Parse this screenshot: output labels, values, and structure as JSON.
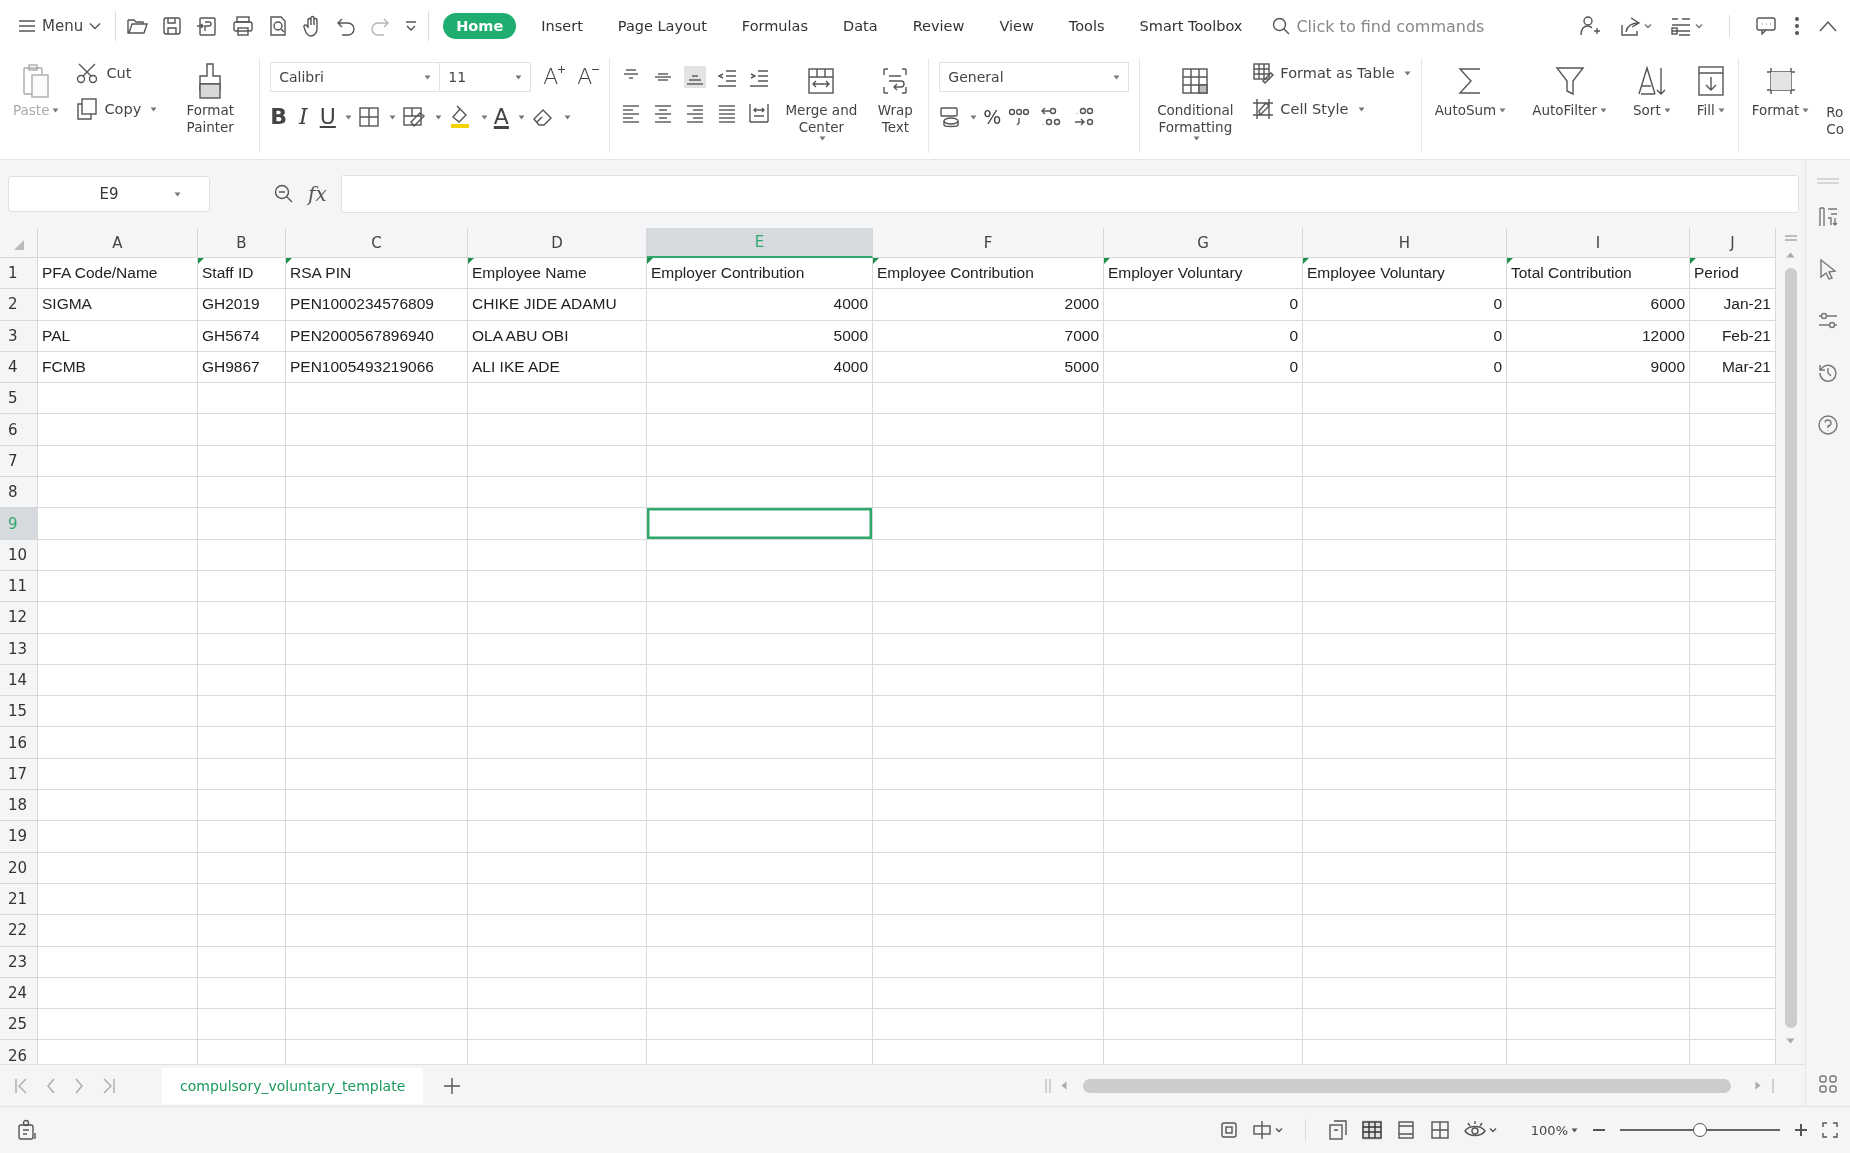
{
  "menu_bar": {
    "menu_label": "Menu",
    "tabs": [
      {
        "label": "Home",
        "selected": true
      },
      {
        "label": "Insert",
        "selected": false
      },
      {
        "label": "Page Layout",
        "selected": false
      },
      {
        "label": "Formulas",
        "selected": false
      },
      {
        "label": "Data",
        "selected": false
      },
      {
        "label": "Review",
        "selected": false
      },
      {
        "label": "View",
        "selected": false
      },
      {
        "label": "Tools",
        "selected": false
      },
      {
        "label": "Smart Toolbox",
        "selected": false
      }
    ],
    "search": {
      "placeholder": "Click to find commands"
    }
  },
  "ribbon": {
    "paste": {
      "label": "Paste",
      "disabled": true
    },
    "cut": "Cut",
    "copy": "Copy",
    "format_painter": "Format Painter",
    "font": "Calibri",
    "font_size": "11",
    "font_grow": "A",
    "font_shrink": "A",
    "bold": "B",
    "italic": "I",
    "underline": "U",
    "font_color": "A",
    "merge": "Merge and Center",
    "wrap": "Wrap Text",
    "number_format": "General",
    "percent": "%",
    "conditional": "Conditional Formatting",
    "format_table": "Format as Table",
    "cell_style": "Cell Style",
    "autosum": "AutoSum",
    "autofilter": "AutoFilter",
    "sort": "Sort",
    "fill": "Fill",
    "format": "Format",
    "cut_off": "Ro Co"
  },
  "formula_bar": {
    "name_box": "E9",
    "fx": "fx"
  },
  "columns": [
    {
      "letter": "A",
      "selected": false
    },
    {
      "letter": "B",
      "selected": false
    },
    {
      "letter": "C",
      "selected": false
    },
    {
      "letter": "D",
      "selected": false
    },
    {
      "letter": "E",
      "selected": true
    },
    {
      "letter": "F",
      "selected": false
    },
    {
      "letter": "G",
      "selected": false
    },
    {
      "letter": "H",
      "selected": false
    },
    {
      "letter": "I",
      "selected": false
    },
    {
      "letter": "J",
      "selected": false
    }
  ],
  "header_row": {
    "number": "1",
    "selected": false,
    "cells": [
      {
        "text": "PFA Code/Name",
        "flag": false
      },
      {
        "text": "Staff ID",
        "flag": true
      },
      {
        "text": "RSA PIN",
        "flag": true
      },
      {
        "text": "Employee Name",
        "flag": true
      },
      {
        "text": "Employer Contribution",
        "flag": true
      },
      {
        "text": "Employee Contribution",
        "flag": true
      },
      {
        "text": "Employer Voluntary",
        "flag": true
      },
      {
        "text": "Employee Voluntary",
        "flag": true
      },
      {
        "text": "Total Contribution",
        "flag": true
      },
      {
        "text": "Period",
        "flag": true
      }
    ]
  },
  "rows": [
    {
      "number": "2",
      "selected": false,
      "cells": [
        "SIGMA",
        "GH2019",
        "PEN1000234576809",
        "CHIKE JIDE ADAMU",
        "4000",
        "2000",
        "0",
        "0",
        "6000",
        "Jan-21"
      ]
    },
    {
      "number": "3",
      "selected": false,
      "cells": [
        "PAL",
        "GH5674",
        "PEN2000567896940",
        "OLA ABU OBI",
        "5000",
        "7000",
        "0",
        "0",
        "12000",
        "Feb-21"
      ]
    },
    {
      "number": "4",
      "selected": false,
      "cells": [
        "FCMB",
        "GH9867",
        "PEN1005493219066",
        "ALI IKE ADE",
        "4000",
        "5000",
        "0",
        "0",
        "9000",
        "Mar-21"
      ]
    },
    {
      "number": "5",
      "selected": false
    },
    {
      "number": "6",
      "selected": false
    },
    {
      "number": "7",
      "selected": false
    },
    {
      "number": "8",
      "selected": false
    },
    {
      "number": "9",
      "selected": true
    },
    {
      "number": "10",
      "selected": false
    },
    {
      "number": "11",
      "selected": false
    },
    {
      "number": "12",
      "selected": false
    },
    {
      "number": "13",
      "selected": false
    },
    {
      "number": "14",
      "selected": false
    },
    {
      "number": "15",
      "selected": false
    },
    {
      "number": "16",
      "selected": false
    },
    {
      "number": "17",
      "selected": false
    },
    {
      "number": "18",
      "selected": false
    },
    {
      "number": "19",
      "selected": false
    },
    {
      "number": "20",
      "selected": false
    },
    {
      "number": "21",
      "selected": false
    },
    {
      "number": "22",
      "selected": false
    },
    {
      "number": "23",
      "selected": false
    },
    {
      "number": "24",
      "selected": false
    },
    {
      "number": "25",
      "selected": false
    },
    {
      "number": "26",
      "selected": false
    }
  ],
  "sheet_tabs": [
    {
      "label": "compulsory_voluntary_template",
      "selected": true
    }
  ],
  "status_bar": {
    "zoom": "100%",
    "zoom_slider": {
      "level": 0.5
    }
  }
}
